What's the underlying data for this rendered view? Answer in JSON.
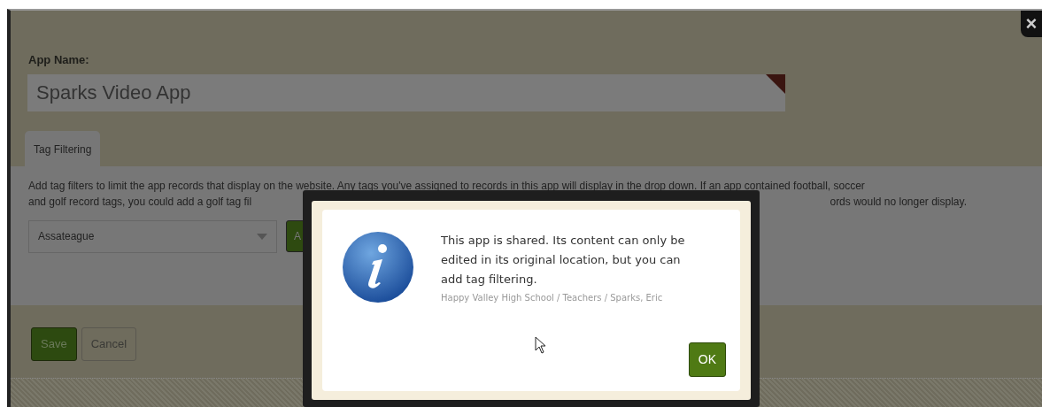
{
  "form": {
    "app_name_label": "App Name:",
    "app_name_value": "Sparks Video App",
    "tabs": [
      {
        "label": "Tag Filtering",
        "selected": true
      }
    ],
    "description": [
      "Add tag filters to limit the app records that display on the website. Any tags you've assigned to records in this app will display in the drop down. If an app contained football, soccer",
      "and golf record tags, you could add a golf tag fil",
      "ords would no longer display."
    ],
    "tag_select": {
      "value": "Assateague"
    },
    "add_button": "A",
    "buttons": [
      {
        "label": "Save",
        "kind": "primary"
      },
      {
        "label": "Cancel",
        "kind": "secondary"
      }
    ]
  },
  "close_button": "×",
  "dialog": {
    "message": "This app is shared. Its content can only be edited in its original location, but you can add tag filtering.",
    "path": "Happy Valley High School / Teachers / Sparks, Eric",
    "ok_button": "OK"
  }
}
